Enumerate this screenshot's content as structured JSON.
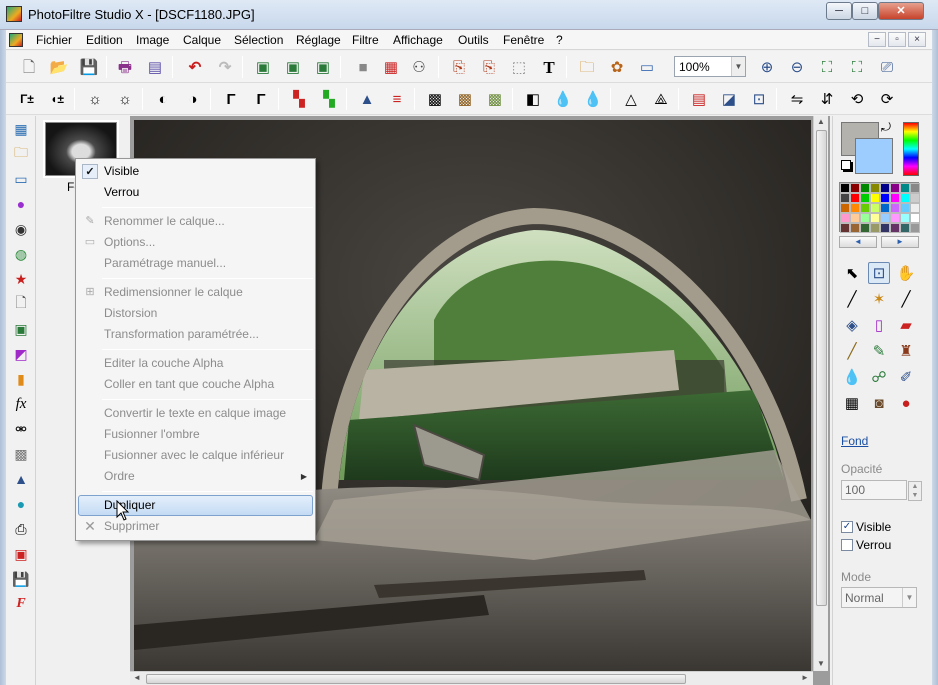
{
  "window": {
    "title": "PhotoFiltre Studio X - [DSCF1180.JPG]",
    "minimize": "─",
    "maximize": "□",
    "close": "✕"
  },
  "menubar": {
    "items": [
      "Fichier",
      "Edition",
      "Image",
      "Calque",
      "Sélection",
      "Réglage",
      "Filtre",
      "Affichage",
      "Outils",
      "Fenêtre",
      "?"
    ],
    "mdi_buttons": [
      "−",
      "▫",
      "×"
    ]
  },
  "toolbar1": {
    "zoom_value": "100%"
  },
  "toolbar2": {
    "text_tool_glyph": "T"
  },
  "layer_panel": {
    "thumbnail_label": "Fo"
  },
  "context_menu": {
    "items": [
      {
        "label": "Visible",
        "state": "checked"
      },
      {
        "label": "Verrou",
        "state": "enabled"
      },
      {
        "label": "Renommer le calque...",
        "state": "disabled"
      },
      {
        "label": "Options...",
        "state": "disabled"
      },
      {
        "label": "Paramétrage manuel...",
        "state": "disabled"
      },
      {
        "label": "Redimensionner le calque",
        "state": "disabled"
      },
      {
        "label": "Distorsion",
        "state": "disabled"
      },
      {
        "label": "Transformation paramétrée...",
        "state": "disabled"
      },
      {
        "label": "Editer la couche Alpha",
        "state": "disabled"
      },
      {
        "label": "Coller en tant que couche Alpha",
        "state": "disabled"
      },
      {
        "label": "Convertir le texte en calque image",
        "state": "disabled"
      },
      {
        "label": "Fusionner l'ombre",
        "state": "disabled"
      },
      {
        "label": "Fusionner avec le calque inférieur",
        "state": "disabled"
      },
      {
        "label": "Ordre",
        "state": "disabled",
        "submenu": true
      },
      {
        "label": "Dupliquer",
        "state": "highlighted"
      },
      {
        "label": "Supprimer",
        "state": "disabled"
      }
    ]
  },
  "right_panel": {
    "tab_fond": "Fond",
    "opacity_label": "Opacité",
    "opacity_value": "100",
    "visible_label": "Visible",
    "visible_checked": true,
    "lock_label": "Verrou",
    "lock_checked": false,
    "mode_label": "Mode",
    "mode_value": "Normal",
    "palette_nav": [
      "◄",
      "►"
    ],
    "colors": {
      "foreground": "#b4b2ac",
      "background": "#9dcdff"
    }
  }
}
